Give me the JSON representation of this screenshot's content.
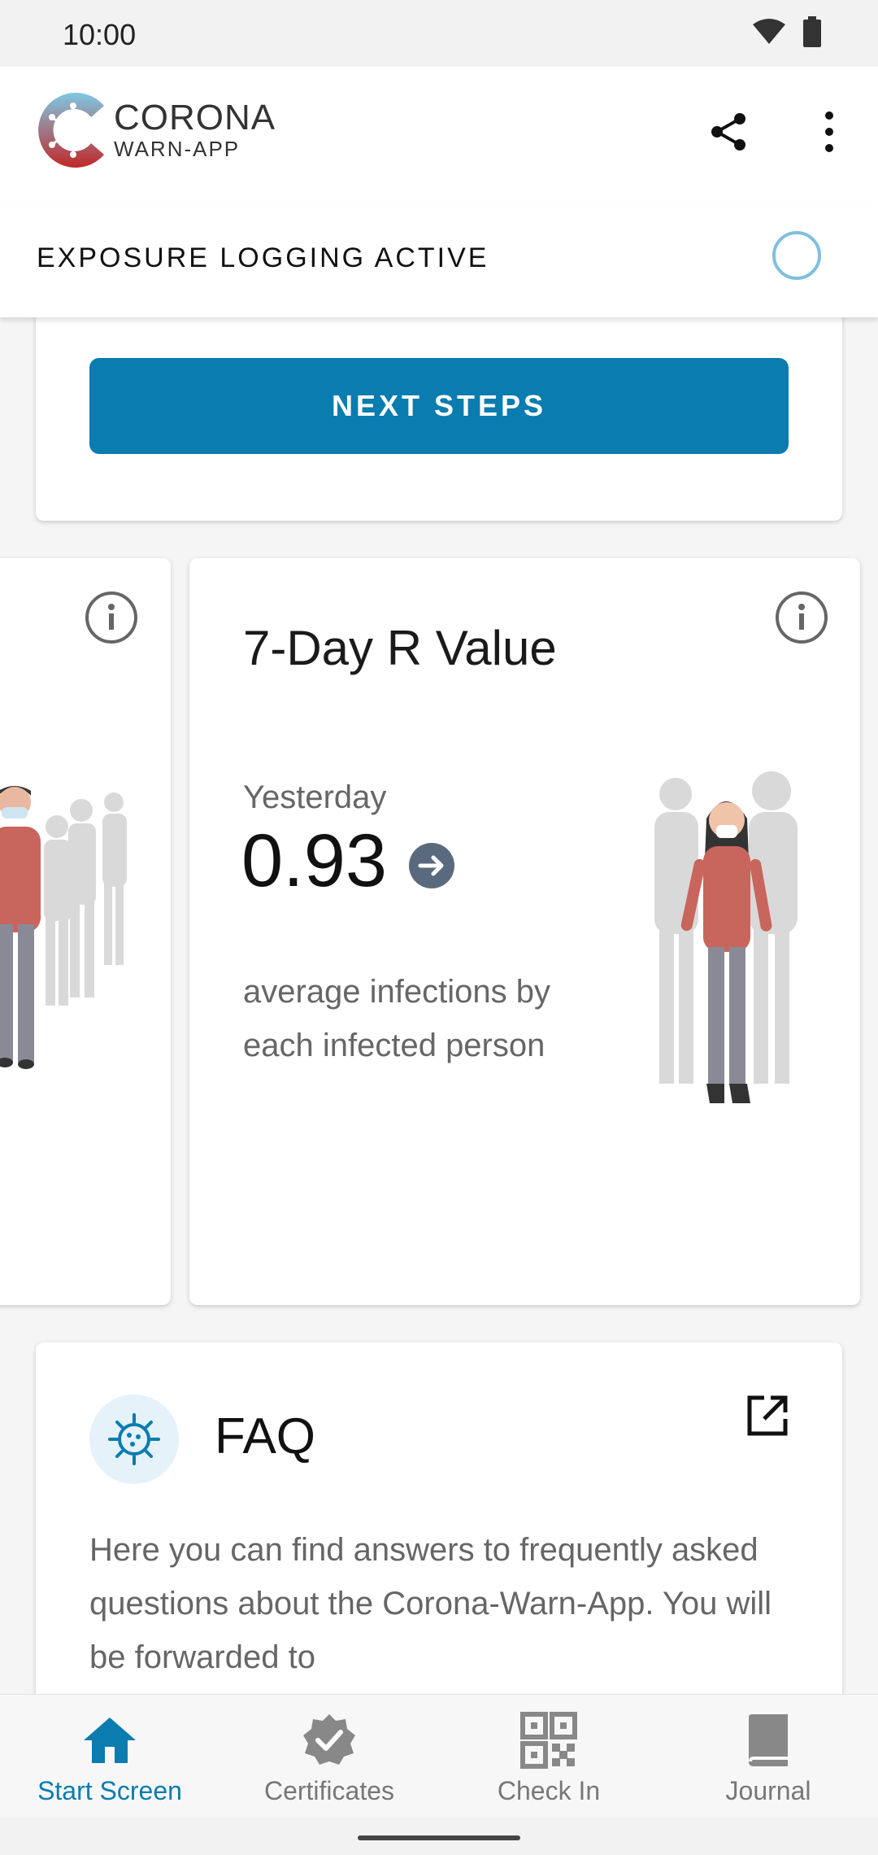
{
  "status_bar": {
    "time": "10:00"
  },
  "app_bar": {
    "logo_line1": "CORONA",
    "logo_line2": "WARN-APP"
  },
  "exposure": {
    "label": "EXPOSURE LOGGING ACTIVE"
  },
  "next_steps": {
    "button_label": "NEXT STEPS"
  },
  "r_value_card": {
    "title": "7-Day R Value",
    "subtitle": "Yesterday",
    "value": "0.93",
    "description": "average infections by each infected person"
  },
  "faq_card": {
    "title": "FAQ",
    "text": "Here you can find answers to frequently asked questions about the Corona-Warn-App. You will be forwarded to"
  },
  "bottom_nav": {
    "items": [
      {
        "label": "Start Screen",
        "icon": "home-icon",
        "active": true
      },
      {
        "label": "Certificates",
        "icon": "certificate-icon",
        "active": false
      },
      {
        "label": "Check In",
        "icon": "qr-code-icon",
        "active": false
      },
      {
        "label": "Journal",
        "icon": "journal-icon",
        "active": false
      }
    ]
  },
  "colors": {
    "accent": "#0a7caf",
    "ring": "#7fbfdd",
    "figure_red": "#c8655c",
    "figure_grey": "#8a8a96"
  }
}
